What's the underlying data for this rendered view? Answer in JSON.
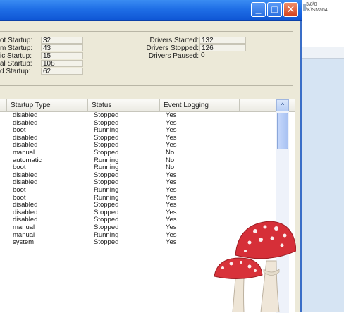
{
  "window": {
    "title": "",
    "controls": {
      "minimize": "_",
      "maximize": "□",
      "close": "✕"
    }
  },
  "background_window": {
    "lines": [
      "3\\8\\0",
      "\\K\\SMan4"
    ]
  },
  "stats": {
    "left": [
      {
        "label": "ot Startup:",
        "value": "32"
      },
      {
        "label": "m Startup:",
        "value": "43"
      },
      {
        "label": "ic Startup:",
        "value": "15"
      },
      {
        "label": "al Startup:",
        "value": "108"
      },
      {
        "label": "d Startup:",
        "value": "62"
      }
    ],
    "right": [
      {
        "label": "Drivers Started:",
        "value": "132"
      },
      {
        "label": "Drivers Stopped:",
        "value": "126"
      },
      {
        "label": "Drivers Paused:",
        "value": "0"
      }
    ]
  },
  "list": {
    "columns": [
      "Startup Type",
      "Status",
      "Event Logging"
    ],
    "rows": [
      [
        "disabled",
        "Stopped",
        "Yes"
      ],
      [
        "disabled",
        "Stopped",
        "Yes"
      ],
      [
        "boot",
        "Running",
        "Yes"
      ],
      [
        "disabled",
        "Stopped",
        "Yes"
      ],
      [
        "disabled",
        "Stopped",
        "Yes"
      ],
      [
        "manual",
        "Stopped",
        "No"
      ],
      [
        "automatic",
        "Running",
        "No"
      ],
      [
        "boot",
        "Running",
        "No"
      ],
      [
        "disabled",
        "Stopped",
        "Yes"
      ],
      [
        "disabled",
        "Stopped",
        "Yes"
      ],
      [
        "boot",
        "Running",
        "Yes"
      ],
      [
        "boot",
        "Running",
        "Yes"
      ],
      [
        "disabled",
        "Stopped",
        "Yes"
      ],
      [
        "disabled",
        "Stopped",
        "Yes"
      ],
      [
        "disabled",
        "Stopped",
        "Yes"
      ],
      [
        "manual",
        "Stopped",
        "Yes"
      ],
      [
        "manual",
        "Running",
        "Yes"
      ],
      [
        "system",
        "Stopped",
        "Yes"
      ]
    ]
  },
  "colors": {
    "titlebar": "#1f6ee6",
    "window_face": "#ece9d8",
    "mushroom_cap": "#d8323a"
  }
}
